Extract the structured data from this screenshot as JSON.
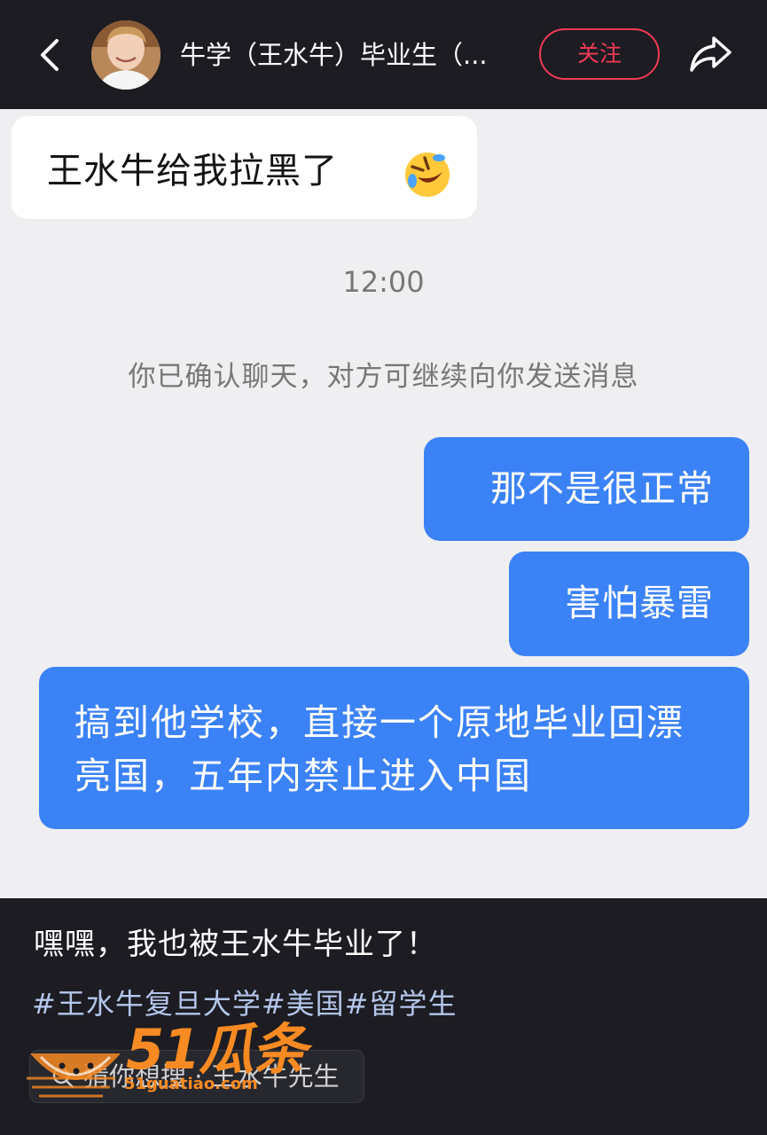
{
  "header": {
    "title": "牛学（王水牛）毕业生（...",
    "follow_label": "关注",
    "icons": {
      "back": "chevron-left-icon",
      "share": "share-arrow-icon"
    }
  },
  "chat": {
    "incoming_message": "王水牛给我拉黑了",
    "incoming_emoji": "rolling-on-floor-laughing-emoji",
    "timestamp": "12:00",
    "system_notice": "你已确认聊天，对方可继续向你发送消息",
    "outgoing_messages": [
      "那不是很正常",
      "害怕暴雷",
      "搞到他学校，直接一个原地毕业回漂亮国，五年内禁止进入中国"
    ]
  },
  "post": {
    "caption": "嘿嘿，我也被王水牛毕业了！",
    "hashtags": "#王水牛复旦大学#美国#留学生",
    "related_search": "猜你想搜 · 王水牛先生"
  },
  "watermark": {
    "brand": "51瓜条",
    "url": "51guatiao.com"
  },
  "colors": {
    "topbar_bg": "#1c1c22",
    "chat_bg": "#efeff1",
    "outgoing_bubble": "#3b82f6",
    "follow_accent": "#f23a57",
    "hashtag": "#b4c6ea",
    "watermark": "#f78a22"
  }
}
